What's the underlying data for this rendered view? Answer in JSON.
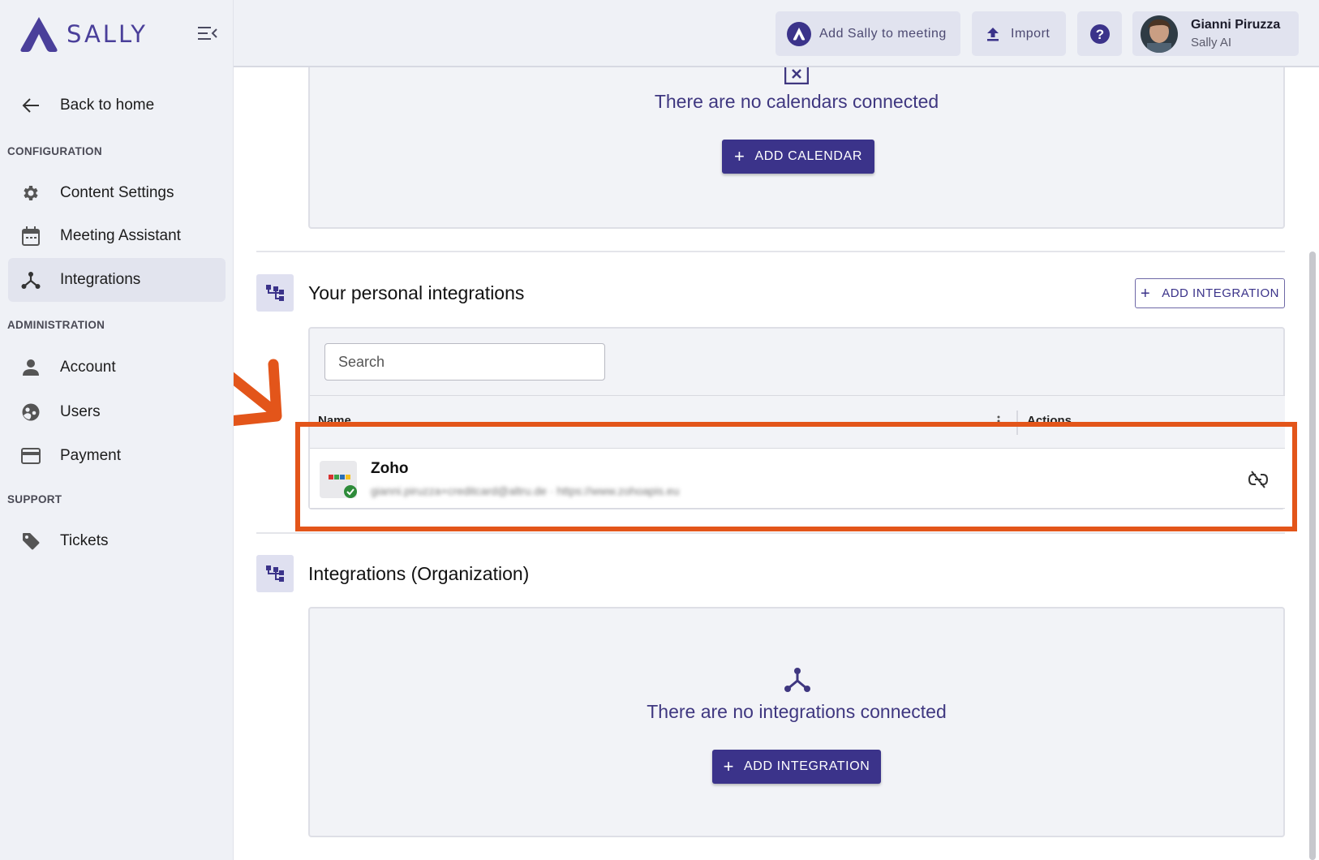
{
  "brand": {
    "name": "SALLY",
    "accent": "#4a3f9a"
  },
  "sidebar": {
    "back_label": "Back to home",
    "sections": {
      "configuration": "CONFIGURATION",
      "administration": "ADMINISTRATION",
      "support": "SUPPORT"
    },
    "items": {
      "content_settings": "Content Settings",
      "meeting_assistant": "Meeting Assistant",
      "integrations": "Integrations",
      "account": "Account",
      "users": "Users",
      "payment": "Payment",
      "tickets": "Tickets"
    },
    "active": "integrations"
  },
  "header": {
    "add_sally_label": "Add Sally to meeting",
    "import_label": "Import",
    "user_name": "Gianni Piruzza",
    "user_org": "Sally AI"
  },
  "calendars": {
    "empty_text": "There are no calendars connected",
    "add_button": "ADD CALENDAR"
  },
  "personal_integrations": {
    "title": "Your personal integrations",
    "add_button": "ADD INTEGRATION",
    "search_placeholder": "Search",
    "columns": [
      "Name",
      "Actions"
    ],
    "rows": [
      {
        "name": "Zoho",
        "detail": "gianni.piruzza+creditcard@altru.de · https://www.zohoapis.eu",
        "logo": "zoho-logo",
        "status": "connected"
      }
    ]
  },
  "org_integrations": {
    "title": "Integrations (Organization)",
    "empty_text": "There are no integrations connected",
    "add_button": "ADD INTEGRATION"
  },
  "annotation_color": "#e3551a"
}
